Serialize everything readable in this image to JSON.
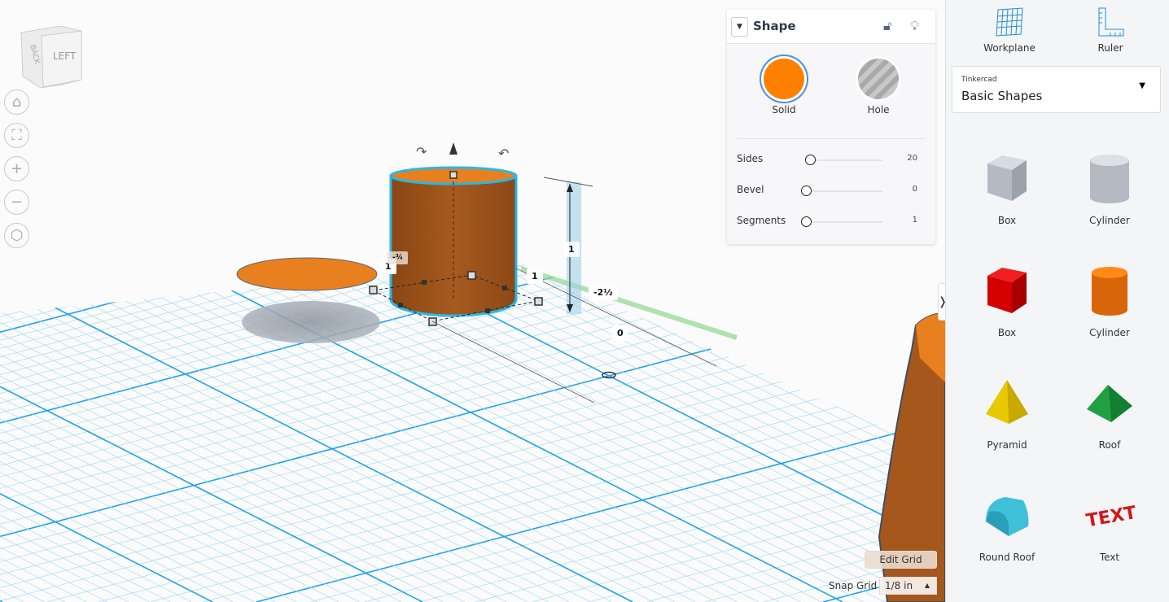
{
  "viewcube": {
    "left": "LEFT",
    "back": "BACK"
  },
  "nav": [
    {
      "icon": "home-icon",
      "glyph": "⌂"
    },
    {
      "icon": "fit-view-icon",
      "glyph": "⛶"
    },
    {
      "icon": "zoom-in-icon",
      "glyph": "+"
    },
    {
      "icon": "zoom-out-icon",
      "glyph": "−"
    },
    {
      "icon": "ortho-view-icon",
      "glyph": "⬡"
    }
  ],
  "shape_panel": {
    "title": "Shape",
    "solid_label": "Solid",
    "hole_label": "Hole",
    "solid_color": "#ff7f00",
    "params": [
      {
        "label": "Sides",
        "value": "20",
        "fraction": 0.05
      },
      {
        "label": "Bevel",
        "value": "0",
        "fraction": 0
      },
      {
        "label": "Segments",
        "value": "1",
        "fraction": 0
      }
    ]
  },
  "dimensions": {
    "height": "1",
    "width": "1",
    "depth": "1",
    "elevation": "-2½",
    "origin": "0",
    "left_offset": "-¾"
  },
  "toolbar": {
    "workplane": "Workplane",
    "ruler": "Ruler"
  },
  "library": {
    "source": "Tinkercad",
    "category": "Basic Shapes"
  },
  "shapes": [
    {
      "label": "Box",
      "kind": "box-hole"
    },
    {
      "label": "Cylinder",
      "kind": "cyl-hole"
    },
    {
      "label": "Box",
      "kind": "box"
    },
    {
      "label": "Cylinder",
      "kind": "cyl"
    },
    {
      "label": "Pyramid",
      "kind": "pyramid"
    },
    {
      "label": "Roof",
      "kind": "roof"
    },
    {
      "label": "Round Roof",
      "kind": "roundroof"
    },
    {
      "label": "Text",
      "kind": "text"
    }
  ],
  "grid": {
    "edit_label": "Edit Grid",
    "snap_label": "Snap Grid",
    "snap_value": "1/8 in"
  },
  "colors": {
    "grid_major": "#1fa3e6",
    "grid_minor": "#a9dbf2",
    "object": "#a6581c",
    "selection": "#29b6e8"
  }
}
